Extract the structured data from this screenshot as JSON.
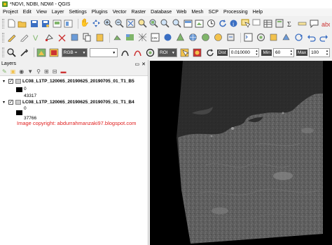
{
  "window": {
    "title": "*NDVI, NDBI, NDWI - QGIS"
  },
  "menu": [
    "Project",
    "Edit",
    "View",
    "Layer",
    "Settings",
    "Plugins",
    "Vector",
    "Raster",
    "Database",
    "Web",
    "Mesh",
    "SCP",
    "Processing",
    "Help"
  ],
  "scp_toolbar": {
    "rgb_label": "RGB =",
    "rgb_value": "",
    "roi_label": "ROI",
    "dist_label": "Dist",
    "dist_value": "0.010000",
    "min_label": "Min",
    "min_value": "60",
    "max_label": "Max",
    "max_value": "100"
  },
  "layers_panel": {
    "title": "Layers",
    "layers": [
      {
        "name": "LC08_L1TP_120065_20190625_20190705_01_T1_B5",
        "min": "0",
        "max": "43317"
      },
      {
        "name": "LC08_L1TP_120065_20190625_20190705_01_T1_B4",
        "min": "0",
        "max": "37766"
      }
    ]
  },
  "watermark": "Image copyright: abdurrahmanzaki97.blogspot.com",
  "icons": {
    "toolbar1": [
      "new-project-icon",
      "open-project-icon",
      "save-project-icon",
      "save-as-icon",
      "print-layout-icon",
      "layout-manager-icon",
      "pan-icon",
      "pan-to-selection-icon",
      "zoom-in-icon",
      "zoom-out-icon",
      "zoom-full-icon",
      "zoom-to-selection-icon",
      "zoom-to-layer-icon",
      "zoom-last-icon",
      "zoom-next-icon",
      "new-map-view-icon",
      "new-3d-view-icon",
      "temporal-controller-icon",
      "refresh-icon",
      "identify-icon",
      "select-icon",
      "deselect-icon",
      "attribute-table-icon",
      "field-calculator-icon",
      "statistics-icon",
      "measure-icon",
      "annotation-icon",
      "label-icon"
    ],
    "toolbar2": [
      "data-source-manager-icon",
      "new-geopackage-icon",
      "new-shapefile-icon",
      "new-spatialite-icon",
      "new-temp-layer-icon",
      "add-vector-icon",
      "add-raster-icon",
      "add-mesh-icon",
      "add-csv-icon",
      "add-postgis-icon",
      "add-spatialite-icon",
      "add-mssql-icon",
      "add-wms-icon",
      "add-wcs-icon",
      "add-wfs-icon",
      "add-arcgis-icon",
      "add-virtual-icon",
      "current-edits-icon",
      "toggle-editing-icon",
      "save-edits-icon",
      "digitize-icon",
      "vertex-tool-icon",
      "delete-icon",
      "cut-icon",
      "copy-icon",
      "paste-icon",
      "undo-icon",
      "redo-icon",
      "python-console-icon",
      "processing-toolbox-icon"
    ]
  },
  "colors": {
    "watermark": "#e02020",
    "qgis_green": "#589632"
  }
}
